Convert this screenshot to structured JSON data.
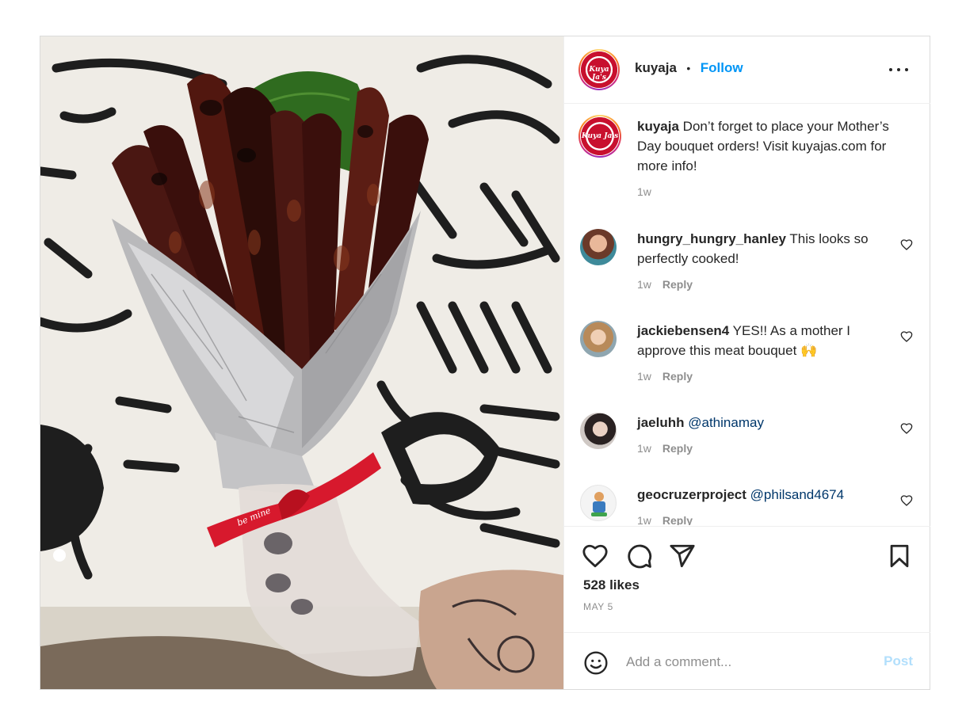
{
  "post": {
    "username": "kuyaja",
    "separator": "•",
    "follow_label": "Follow",
    "logo_text": "Kuya Ja's",
    "likes": "528 likes",
    "date": "MAY 5",
    "photo_ribbon_text": "be mine",
    "caption": {
      "username": "kuyaja",
      "text": "Don’t forget to place your Mother’s Day bouquet orders! Visit kuyajas.com for more info!",
      "time": "1w"
    },
    "comments": [
      {
        "username": "hungry_hungry_hanley",
        "text": "This looks so perfectly cooked!",
        "time": "1w",
        "reply_label": "Reply"
      },
      {
        "username": "jackiebensen4",
        "text": "YES!! As a mother I approve this meat bouquet 🙌",
        "time": "1w",
        "reply_label": "Reply"
      },
      {
        "username": "jaeluhh",
        "text": "@athinamay",
        "time": "1w",
        "reply_label": "Reply"
      },
      {
        "username": "geocruzerproject",
        "text": "@philsand4674",
        "time": "1w",
        "reply_label": "Reply"
      }
    ]
  },
  "composer": {
    "placeholder": "Add a comment...",
    "post_label": "Post"
  },
  "icons": {
    "more": "more-options-icon",
    "like": "heart-icon",
    "comment": "comment-bubble-icon",
    "share": "paper-plane-icon",
    "save": "bookmark-icon",
    "emoji": "emoji-smiley-icon"
  },
  "colors": {
    "link_blue": "#0095f6",
    "mention": "#00376b",
    "muted": "#8e8e8e",
    "post_disabled": "#b2dffc",
    "ribbon_red": "#d7192d"
  }
}
